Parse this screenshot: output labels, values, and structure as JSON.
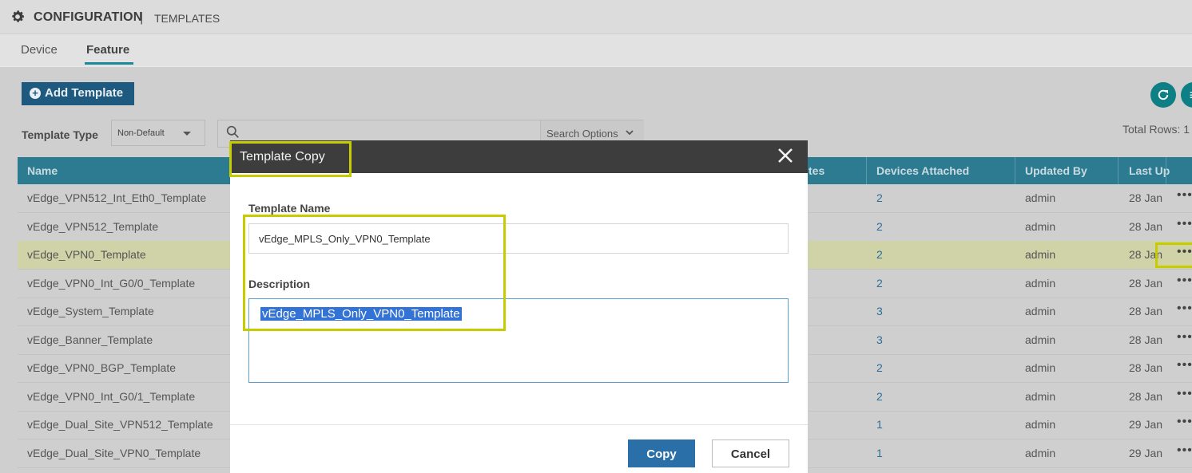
{
  "header": {
    "title": "CONFIGURATION",
    "separator": "|",
    "subtitle": "TEMPLATES"
  },
  "tabs": [
    {
      "label": "Device",
      "active": false
    },
    {
      "label": "Feature",
      "active": true
    }
  ],
  "toolbar": {
    "add_template_label": "Add Template",
    "template_type_label": "Template Type",
    "template_type_value": "Non-Default",
    "search_options_label": "Search Options",
    "total_rows_label": "Total Rows: 1"
  },
  "table": {
    "columns": [
      "Name",
      "tes",
      "Devices Attached",
      "Updated By",
      "Last Up"
    ],
    "rows": [
      {
        "name": "vEdge_VPN512_Int_Eth0_Template",
        "devices": "2",
        "updated_by": "admin",
        "last": "28 Jan"
      },
      {
        "name": "vEdge_VPN512_Template",
        "devices": "2",
        "updated_by": "admin",
        "last": "28 Jan"
      },
      {
        "name": "vEdge_VPN0_Template",
        "devices": "2",
        "updated_by": "admin",
        "last": "28 Jan"
      },
      {
        "name": "vEdge_VPN0_Int_G0/0_Template",
        "devices": "2",
        "updated_by": "admin",
        "last": "28 Jan"
      },
      {
        "name": "vEdge_System_Template",
        "devices": "3",
        "updated_by": "admin",
        "last": "28 Jan"
      },
      {
        "name": "vEdge_Banner_Template",
        "devices": "3",
        "updated_by": "admin",
        "last": "28 Jan"
      },
      {
        "name": "vEdge_VPN0_BGP_Template",
        "devices": "2",
        "updated_by": "admin",
        "last": "28 Jan"
      },
      {
        "name": "vEdge_VPN0_Int_G0/1_Template",
        "devices": "2",
        "updated_by": "admin",
        "last": "28 Jan"
      },
      {
        "name": "vEdge_Dual_Site_VPN512_Template",
        "devices": "1",
        "updated_by": "admin",
        "last": "29 Jan"
      },
      {
        "name": "vEdge_Dual_Site_VPN0_Template",
        "devices": "1",
        "updated_by": "admin",
        "last": "29 Jan"
      }
    ],
    "more_glyph": "•••"
  },
  "modal": {
    "title": "Template Copy",
    "template_name_label": "Template Name",
    "template_name_value": "vEdge_MPLS_Only_VPN0_Template",
    "description_label": "Description",
    "description_value": "vEdge_MPLS_Only_VPN0_Template",
    "copy_label": "Copy",
    "cancel_label": "Cancel"
  },
  "colors": {
    "header_bg": "#2d7b91",
    "accent": "#1a8a9b",
    "highlight": "#c7cc00",
    "primary_button": "#2a6fa8"
  }
}
